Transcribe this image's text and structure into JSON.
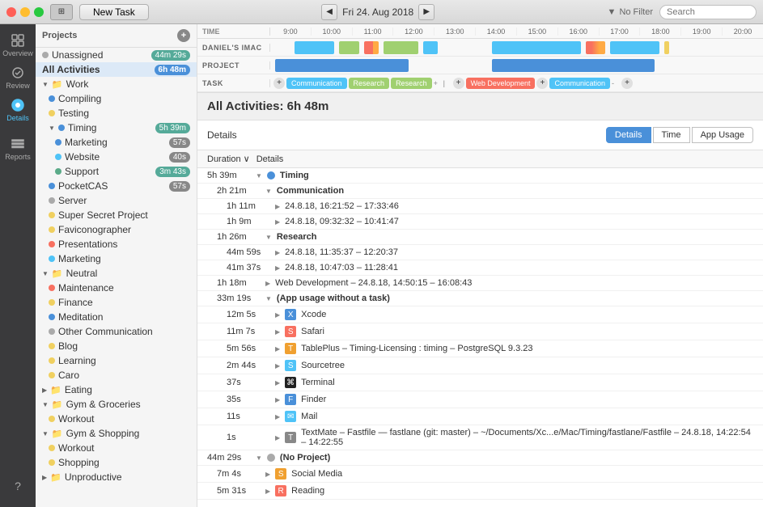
{
  "toolbar": {
    "new_task_label": "New Task",
    "date_label": "Fri 24. Aug 2018",
    "filter_label": "No Filter",
    "search_placeholder": "Search",
    "nav_prev": "◀",
    "nav_next": "▶"
  },
  "icon_sidebar": {
    "items": [
      {
        "name": "overview",
        "label": "Overview",
        "icon": "⊞"
      },
      {
        "name": "review",
        "label": "Review",
        "icon": "✓"
      },
      {
        "name": "details",
        "label": "Details",
        "icon": "◉",
        "active": true
      },
      {
        "name": "reports",
        "label": "Reports",
        "icon": "≡"
      }
    ],
    "help": "?"
  },
  "sidebar": {
    "header": "Projects",
    "items": [
      {
        "id": "unassigned",
        "label": "Unassigned",
        "badge": "44m 29s",
        "badge_color": "green",
        "indent": 0,
        "dot": "#aaa"
      },
      {
        "id": "all-activities",
        "label": "All Activities",
        "badge": "6h 48m",
        "badge_color": "blue",
        "indent": 0,
        "bold": true,
        "selected": true
      },
      {
        "id": "work",
        "label": "Work",
        "indent": 0,
        "has_arrow": true,
        "folder": true
      },
      {
        "id": "compiling",
        "label": "Compiling",
        "indent": 1,
        "dot": "#4a90d9"
      },
      {
        "id": "testing",
        "label": "Testing",
        "indent": 1,
        "dot": "#f0d060"
      },
      {
        "id": "timing",
        "label": "Timing",
        "indent": 1,
        "badge": "5h 39m",
        "dot": "#4a90d9",
        "has_arrow": true
      },
      {
        "id": "marketing",
        "label": "Marketing",
        "indent": 2,
        "dot": "#4a90d9",
        "badge": "57s"
      },
      {
        "id": "website",
        "label": "Website",
        "indent": 2,
        "dot": "#4fc3f7",
        "badge": "40s"
      },
      {
        "id": "support",
        "label": "Support",
        "indent": 2,
        "dot": "#5a9",
        "badge": "3m 43s"
      },
      {
        "id": "pocketcas",
        "label": "PocketCAS",
        "indent": 1,
        "dot": "#4a90d9",
        "badge": "57s"
      },
      {
        "id": "server",
        "label": "Server",
        "indent": 1,
        "dot": "#aaa"
      },
      {
        "id": "super-secret",
        "label": "Super Secret Project",
        "indent": 1,
        "dot": "#f0d060"
      },
      {
        "id": "faviconographer",
        "label": "Faviconographer",
        "indent": 1,
        "dot": "#f0d060"
      },
      {
        "id": "presentations",
        "label": "Presentations",
        "indent": 1,
        "dot": "#f87060"
      },
      {
        "id": "marketing2",
        "label": "Marketing",
        "indent": 1,
        "dot": "#4fc3f7"
      },
      {
        "id": "neutral",
        "label": "Neutral",
        "indent": 0,
        "has_arrow": true,
        "folder": true
      },
      {
        "id": "maintenance",
        "label": "Maintenance",
        "indent": 1,
        "dot": "#f87060"
      },
      {
        "id": "finance",
        "label": "Finance",
        "indent": 1,
        "dot": "#f0d060"
      },
      {
        "id": "meditation",
        "label": "Meditation",
        "indent": 1,
        "dot": "#4a90d9"
      },
      {
        "id": "other-comm",
        "label": "Other Communication",
        "indent": 1,
        "dot": "#aaa"
      },
      {
        "id": "blog",
        "label": "Blog",
        "indent": 1,
        "dot": "#f0d060"
      },
      {
        "id": "learning",
        "label": "Learning",
        "indent": 1,
        "dot": "#f0d060"
      },
      {
        "id": "caro",
        "label": "Caro",
        "indent": 1,
        "dot": "#f0d060"
      },
      {
        "id": "eating",
        "label": "Eating",
        "indent": 0,
        "has_arrow": true,
        "folder": true
      },
      {
        "id": "gym-groceries",
        "label": "Gym & Groceries",
        "indent": 0,
        "has_arrow": true,
        "folder": true
      },
      {
        "id": "workout",
        "label": "Workout",
        "indent": 1,
        "dot": "#f0d060"
      },
      {
        "id": "gym-shopping",
        "label": "Gym & Shopping",
        "indent": 0,
        "has_arrow": true,
        "folder": true
      },
      {
        "id": "workout2",
        "label": "Workout",
        "indent": 1,
        "dot": "#f0d060"
      },
      {
        "id": "shopping",
        "label": "Shopping",
        "indent": 1,
        "dot": "#f0d060"
      },
      {
        "id": "unproductive",
        "label": "Unproductive",
        "indent": 0,
        "has_arrow": true,
        "folder": true
      }
    ]
  },
  "timeline": {
    "time_slots": [
      "9:00",
      "10:00",
      "11:00",
      "12:00",
      "13:00",
      "14:00",
      "15:00",
      "16:00",
      "17:00",
      "18:00",
      "19:00",
      "20:00"
    ],
    "rows": [
      {
        "label": "DANIEL'S IMAC"
      },
      {
        "label": "PROJECT"
      },
      {
        "label": "TASK"
      }
    ],
    "task_labels": [
      "Communication",
      "Research",
      "Research",
      "Web Development",
      "Communication"
    ]
  },
  "detail_panel": {
    "all_activities_label": "All Activities: 6h 48m",
    "section": "Details",
    "tabs": [
      "Details",
      "Time",
      "App Usage"
    ],
    "active_tab": "Details",
    "col_duration": "Duration",
    "col_details": "Details",
    "rows": [
      {
        "duration": "5h 39m",
        "label": "Timing",
        "indent": 0,
        "dot": "#4a90d9",
        "type": "section",
        "expanded": true
      },
      {
        "duration": "2h 21m",
        "label": "Communication",
        "indent": 1,
        "type": "section",
        "expanded": true
      },
      {
        "duration": "1h 11m",
        "label": "24.8.18, 16:21:52 – 17:33:46",
        "indent": 2,
        "type": "entry"
      },
      {
        "duration": "1h 9m",
        "label": "24.8.18, 09:32:32 – 10:41:47",
        "indent": 2,
        "type": "entry"
      },
      {
        "duration": "1h 26m",
        "label": "Research",
        "indent": 1,
        "type": "section",
        "expanded": true
      },
      {
        "duration": "44m 59s",
        "label": "24.8.18, 11:35:37 – 12:20:37",
        "indent": 2,
        "type": "entry"
      },
      {
        "duration": "41m 37s",
        "label": "24.8.18, 10:47:03 – 11:28:41",
        "indent": 2,
        "type": "entry"
      },
      {
        "duration": "1h 18m",
        "label": "Web Development – 24.8.18, 14:50:15 – 16:08:43",
        "indent": 1,
        "type": "entry"
      },
      {
        "duration": "33m 19s",
        "label": "(App usage without a task)",
        "indent": 1,
        "type": "section",
        "expanded": true
      },
      {
        "duration": "12m 5s",
        "label": "Xcode",
        "indent": 2,
        "type": "app",
        "app_color": "#4a90d9"
      },
      {
        "duration": "11m 7s",
        "label": "Safari",
        "indent": 2,
        "type": "app",
        "app_color": "#f87060"
      },
      {
        "duration": "5m 56s",
        "label": "TablePlus – Timing-Licensing : timing – PostgreSQL 9.3.23",
        "indent": 2,
        "type": "app",
        "app_color": "#f0a030"
      },
      {
        "duration": "2m 44s",
        "label": "Sourcetree",
        "indent": 2,
        "type": "app",
        "app_color": "#4fc3f7"
      },
      {
        "duration": "37s",
        "label": "Terminal",
        "indent": 2,
        "type": "app",
        "app_color": "#333"
      },
      {
        "duration": "35s",
        "label": "Finder",
        "indent": 2,
        "type": "app",
        "app_color": "#4a90d9"
      },
      {
        "duration": "11s",
        "label": "Mail",
        "indent": 2,
        "type": "app",
        "app_color": "#4fc3f7"
      },
      {
        "duration": "1s",
        "label": "TextMate – Fastfile — fastlane (git: master) – ~/Documents/Xc...e/Mac/Timing/fastlane/Fastfile – 24.8.18, 14:22:54 – 14:22:55",
        "indent": 2,
        "type": "app",
        "app_color": "#666"
      },
      {
        "duration": "44m 29s",
        "label": "(No Project)",
        "indent": 0,
        "dot": "#aaa",
        "type": "section",
        "expanded": true
      },
      {
        "duration": "7m 4s",
        "label": "Social Media",
        "indent": 1,
        "type": "app",
        "app_color": "#f0a030"
      },
      {
        "duration": "5m 31s",
        "label": "Reading",
        "indent": 1,
        "type": "app",
        "app_color": "#f87060"
      }
    ]
  },
  "colors": {
    "communication": "#4fc3f7",
    "research": "#a0d070",
    "web_dev": "#f87060",
    "timing_bar": "#4a90d9",
    "accent_blue": "#4a90d9"
  }
}
